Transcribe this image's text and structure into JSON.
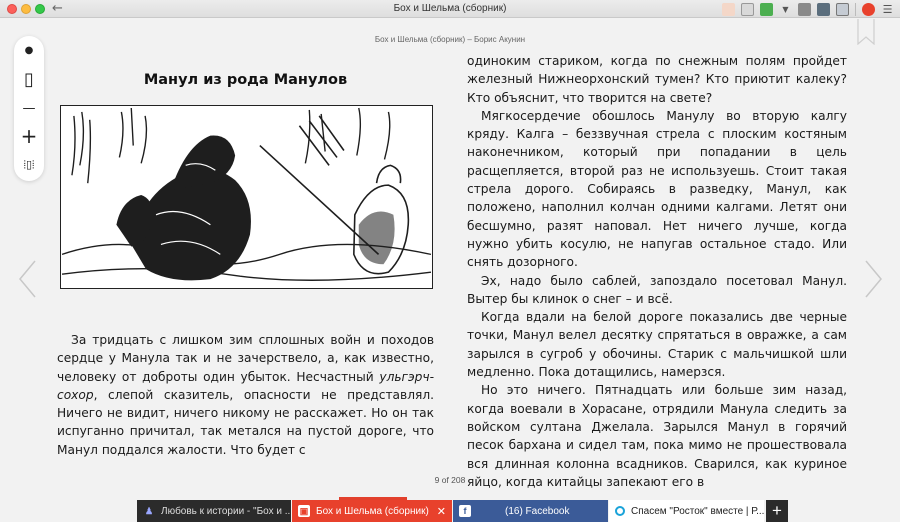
{
  "window": {
    "title": "Бох и Шельма (сборник)",
    "back_glyph": "←"
  },
  "reader": {
    "running_head": "Бох и Шельма (сборник)   –   Борис Акунин",
    "chapter_title": "Манул из рода Манулов",
    "page_counter": "9 of 208",
    "left_paragraphs": [
      "За тридцать с лишком зим сплошных войн и походов сердце у Манула так и не зачерствело, а, как известно, человеку от доброты один убыток. Несчастный ",
      "ульгэрч-сохор",
      ", слепой сказитель, опасности не представлял. Ничего не видит, ничего никому не расскажет. Но он так испуганно причитал, так метался на пустой дороге, что Манул поддался жалости. Что будет с"
    ],
    "right_paragraphs": [
      "одиноким стариком, когда по снежным полям пройдет железный Нижнеорхонский тумен? Кто приютит калеку? Кто объяснит, что творится на свете?",
      "Мягкосердечие обошлось Манулу во вторую калгу кряду. Калга – беззвучная стрела с плоским костяным наконечником, который при попадании в цель расщепляется, второй раз не используешь. Стоит такая стрела дорого. Собираясь в разведку, Манул, как положено, наполнил колчан одними калгами. Летят они бесшумно, разят наповал. Нет ничего лучше, когда нужно убить косулю, не напугав остальное стадо. Или снять дозорного.",
      "Эх, надо было саблей, запоздало посетовал Манул. Вытер бы клинок о снег – и всё.",
      "Когда вдали на белой дороге показались две черные точки, Манул велел десятку спрятаться в овражке, а сам зарылся в сугроб у обочины. Старик с мальчишкой шли медленно. Пока дотащились, намерзся.",
      "Но это ничего. Пятнадцать или больше зим назад, когда воевали в Хорасане, отрядили Манула следить за войском султана Джелала. Зарылся Манул в горячий песок бархана и сидел там, пока мимо не прошествовала вся длинная колонна всадников. Сварился, как куриное яйцо, когда китайцы запекают его в"
    ],
    "progress": 0.043
  },
  "toolbar": {
    "dot_glyph": "●",
    "page_glyph": "▯",
    "minus_glyph": "—",
    "plus_glyph": "+",
    "vibrate_glyph": "⦙▯⦙"
  },
  "tabs": [
    {
      "label": "Любовь к истории - \"Бох и ...",
      "icon": "user-icon"
    },
    {
      "label": "Бох и Шельма (сборник)",
      "close": "✕",
      "icon": "book-icon"
    },
    {
      "label": "(16) Facebook",
      "icon": "facebook-icon",
      "fav_glyph": "f"
    },
    {
      "label": "Спасем \"Росток\" вместе | Р...",
      "icon": "globe-icon"
    }
  ],
  "new_tab_label": "+",
  "colors": {
    "accent_red": "#e8412c",
    "facebook_blue": "#3b5b98",
    "dark_tab": "#2b2b2b"
  }
}
